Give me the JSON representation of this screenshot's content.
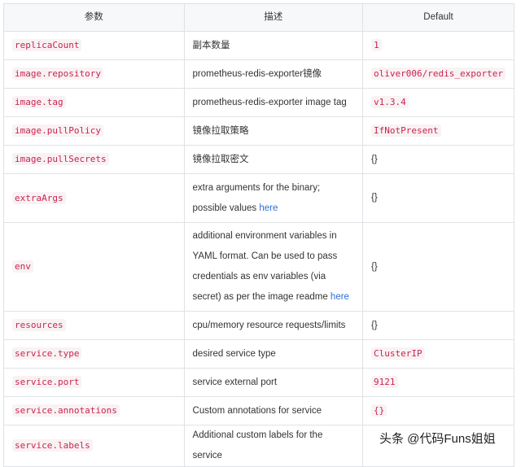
{
  "headers": [
    "参数",
    "描述",
    "Default"
  ],
  "rows": [
    {
      "param": "replicaCount",
      "desc": "副本数量",
      "default": "1",
      "default_code": true
    },
    {
      "param": "image.repository",
      "desc": "prometheus-redis-exporter镜像",
      "default": "oliver006/redis_exporter",
      "default_code": true
    },
    {
      "param": "image.tag",
      "desc": "prometheus-redis-exporter image tag",
      "default": "v1.3.4",
      "default_code": true
    },
    {
      "param": "image.pullPolicy",
      "desc": "镜像拉取策略",
      "default": "IfNotPresent",
      "default_code": true
    },
    {
      "param": "image.pullSecrets",
      "desc": "镜像拉取密文",
      "default": "{}",
      "default_code": false
    },
    {
      "param": "extraArgs",
      "desc": "extra arguments for the binary; possible values ",
      "link": "here",
      "default": "{}",
      "default_code": false
    },
    {
      "param": "env",
      "desc": "additional environment variables in YAML format. Can be used to pass credentials as env variables (via secret) as per the image readme ",
      "link": "here",
      "default": "{}",
      "default_code": false
    },
    {
      "param": "resources",
      "desc": "cpu/memory resource requests/limits",
      "default": "{}",
      "default_code": false
    },
    {
      "param": "service.type",
      "desc": "desired service type",
      "default": "ClusterIP",
      "default_code": true
    },
    {
      "param": "service.port",
      "desc": "service external port",
      "default": "9121",
      "default_code": true
    },
    {
      "param": "service.annotations",
      "desc": "Custom annotations for service",
      "default": "{}",
      "default_code": true
    },
    {
      "param": "service.labels",
      "desc": "Additional custom labels for the service",
      "default": "",
      "default_code": false
    }
  ],
  "watermark": "头条 @代码Funs姐姐"
}
